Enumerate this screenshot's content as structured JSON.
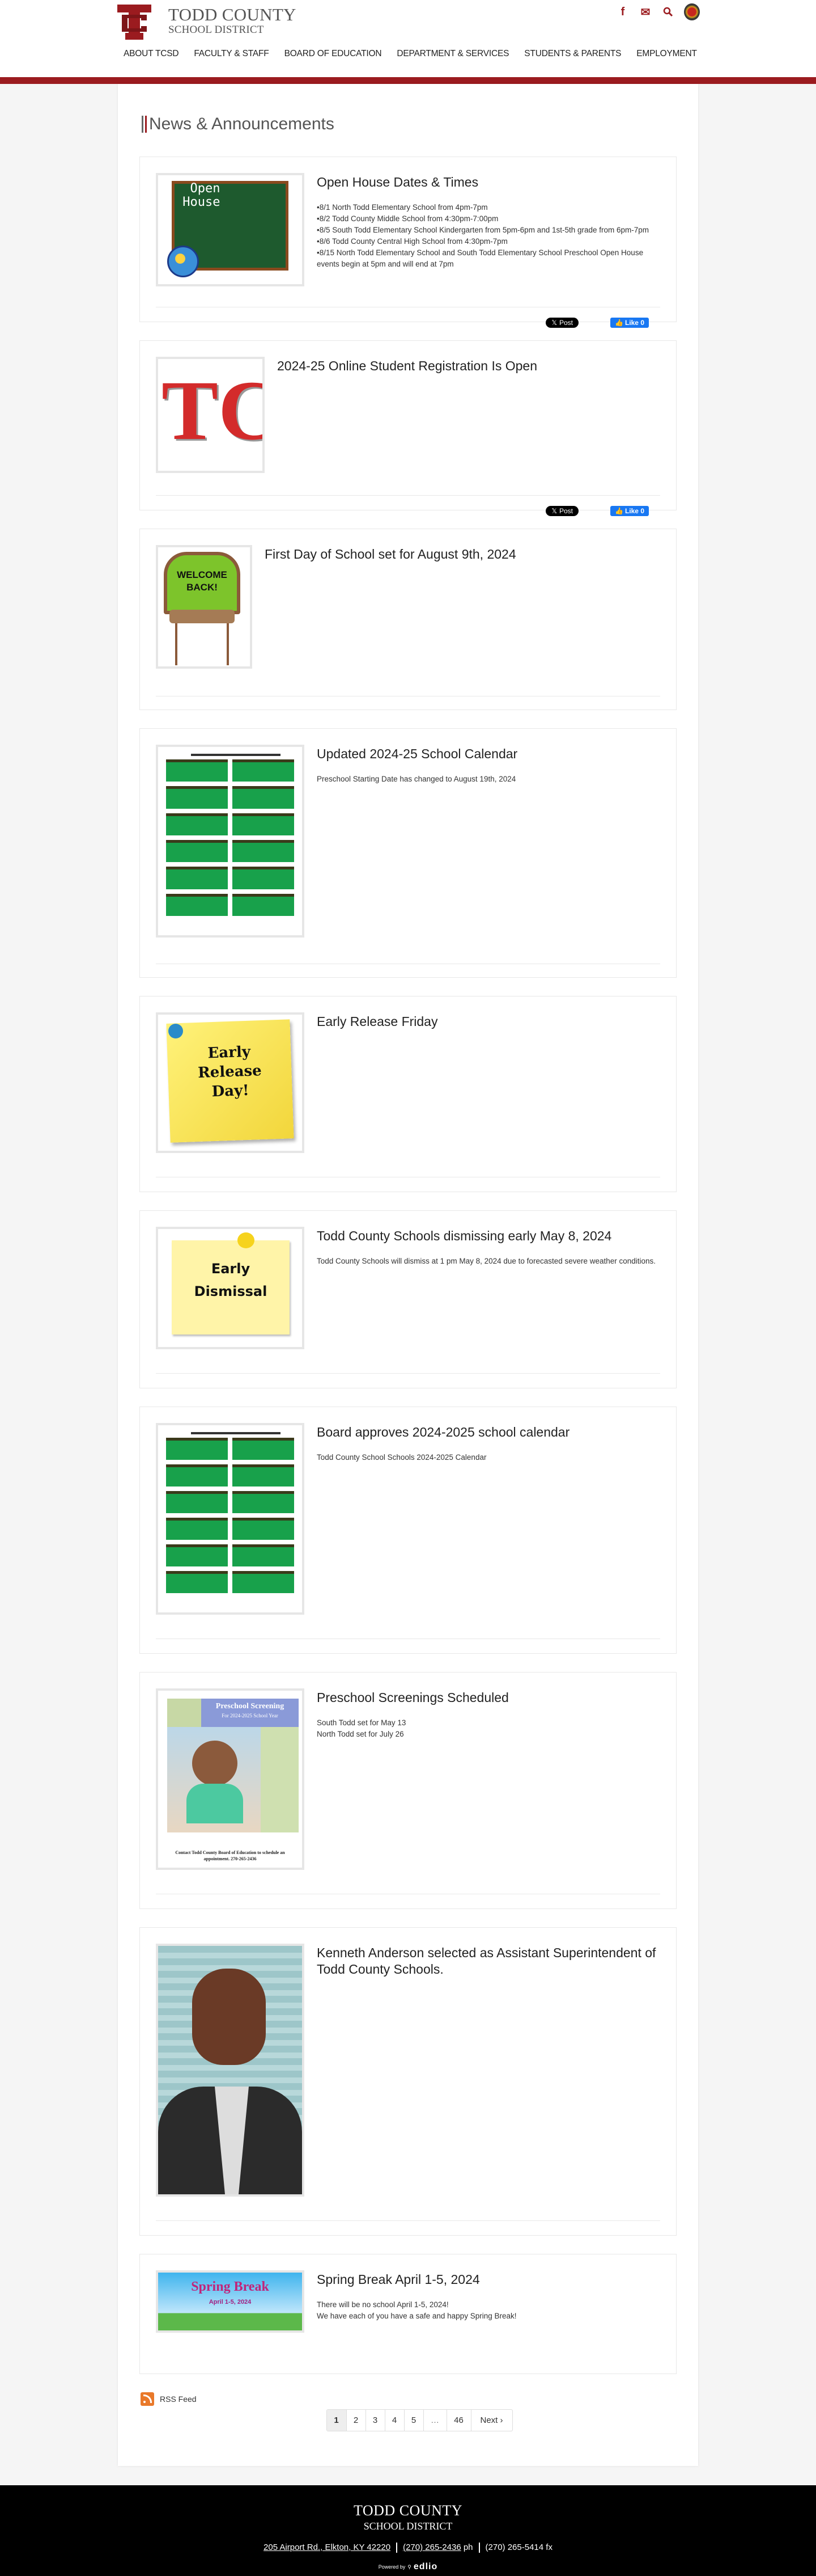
{
  "header": {
    "brand_line1": "TODD COUNTY",
    "brand_line2": "SCHOOL DISTRICT",
    "logo_text": "TC",
    "icons": [
      "facebook-icon",
      "email-icon",
      "search-icon",
      "district-seal"
    ],
    "icon_glyphs": {
      "facebook": "f",
      "email": "✉",
      "search": "⚲"
    },
    "nav": [
      "ABOUT TCSD",
      "FACULTY & STAFF",
      "BOARD OF EDUCATION",
      "DEPARTMENT & SERVICES",
      "STUDENTS & PARENTS",
      "EMPLOYMENT"
    ],
    "accent_color": "#9b1b1f"
  },
  "page": {
    "title": "News & Announcements"
  },
  "social": {
    "post_label": "Post",
    "like_label": "Like 0"
  },
  "news": [
    {
      "title": "Open House Dates & Times",
      "image_alt": "Open House",
      "body": [
        "•8/1 North Todd Elementary School from 4pm-7pm",
        "•8/2 Todd County Middle School from 4:30pm-7:00pm",
        "•8/5 South Todd Elementary School Kindergarten from 5pm-6pm and 1st-5th grade from 6pm-7pm",
        "•8/6 Todd County Central High School from 4:30pm-7pm",
        "•8/15 North Todd Elementary School and South Todd Elementary School Preschool Open House events begin at 5pm and will end at 7pm"
      ]
    },
    {
      "title": "2024-25 Online Student Registration Is Open",
      "image_alt": "TC",
      "body": []
    },
    {
      "title": "First Day of School set for August 9th, 2024",
      "image_alt": "Welcome Back!",
      "body": []
    },
    {
      "title": "Updated 2024-25 School Calendar",
      "image_alt": "Todd County School District 2024-2025 Calendar",
      "body": [
        "Preschool Starting Date has changed to August 19th, 2024"
      ]
    },
    {
      "title": "Early Release Friday",
      "image_alt": "Early Release Day!",
      "body": []
    },
    {
      "title": "Todd County Schools dismissing early May 8, 2024",
      "image_alt": "Early Dismissal",
      "body": [
        "Todd County Schools will dismiss at 1 pm May 8, 2024 due to forecasted severe weather conditions."
      ]
    },
    {
      "title": "Board approves 2024-2025 school calendar",
      "image_alt": "Todd County School District 2024-2025 Calendar",
      "body": [
        "Todd County School Schools 2024-2025 Calendar"
      ]
    },
    {
      "title": "Preschool Screenings Scheduled",
      "image_alt": "Preschool Screening",
      "image_heading": "Preschool Screening",
      "image_subheading": "For 2024-2025 School Year",
      "image_footer": "Contact Todd County Board of Education to schedule an appointment. 270-265-2436",
      "body": [
        "South Todd set for May 13",
        "North Todd set for July 26"
      ]
    },
    {
      "title": "Kenneth Anderson selected as Assistant Superintendent of Todd County Schools.",
      "image_alt": "Kenneth Anderson",
      "body": []
    },
    {
      "title": "Spring Break April 1-5, 2024",
      "image_alt": "Spring Break",
      "image_heading": "Spring Break",
      "image_subheading": "April 1-5, 2024",
      "body": [
        "There will be no school April 1-5, 2024!",
        "We have each of you have a safe and happy Spring Break!"
      ]
    }
  ],
  "rss": {
    "label": "RSS Feed"
  },
  "pagination": {
    "current": "1",
    "pages": [
      "1",
      "2",
      "3",
      "4",
      "5",
      "…",
      "46"
    ],
    "next_label": "Next ›"
  },
  "footer": {
    "line1": "TODD COUNTY",
    "line2": "SCHOOL DISTRICT",
    "address": "205 Airport Rd., Elkton, KY 42220",
    "phone": "(270) 265-2436",
    "phone_suffix": "ph",
    "fax": "(270) 265-5414 fx",
    "powered_by": "Powered by",
    "powered_brand": "edlio"
  }
}
